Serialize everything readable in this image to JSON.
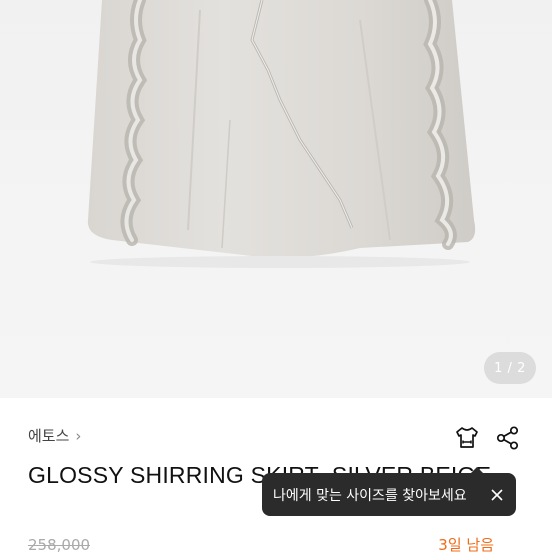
{
  "gallery": {
    "counter": "1 / 2"
  },
  "product": {
    "brand": "에토스",
    "brand_chevron": "›",
    "title": "GLOSSY SHIRRING SKIRT_SILVER BEIGE",
    "original_price": "258,000",
    "remaining": "3일 남음"
  },
  "tooltip": {
    "text": "나에게 맞는 사이즈를 찾아보세요"
  },
  "icons": [
    "shirt-size-icon",
    "share-icon",
    "close-icon",
    "chevron-right-icon"
  ],
  "colors": {
    "accent_orange": "#ef6c1a",
    "tooltip_bg": "#2b2b2b",
    "photo_bg": "#f3f3f3"
  }
}
